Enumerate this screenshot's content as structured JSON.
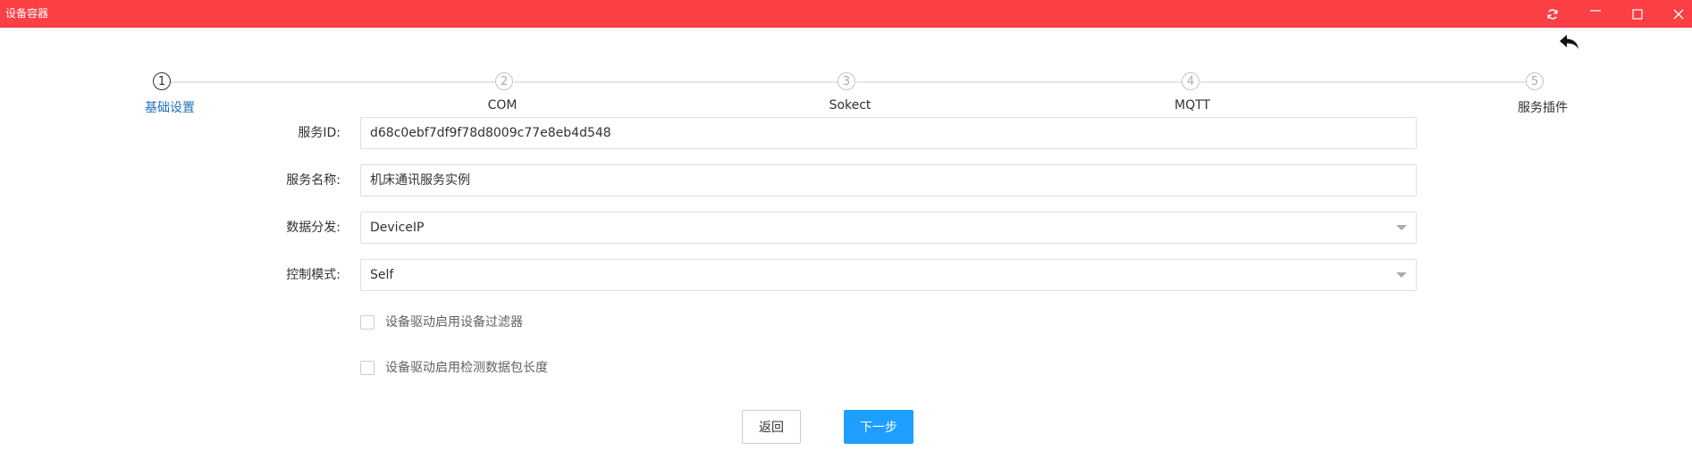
{
  "window": {
    "title": "设备容器",
    "controls": [
      "refresh-icon",
      "minimize-icon",
      "maximize-icon",
      "close-icon"
    ]
  },
  "toolbar": {
    "back_icon": "undo-arrow-icon"
  },
  "steps": [
    {
      "number": "1",
      "label": "基础设置",
      "active": true
    },
    {
      "number": "2",
      "label": "COM",
      "active": false
    },
    {
      "number": "3",
      "label": "Sokect",
      "active": false
    },
    {
      "number": "4",
      "label": "MQTT",
      "active": false
    },
    {
      "number": "5",
      "label": "服务插件",
      "active": false
    }
  ],
  "form": {
    "service_id_label": "服务ID:",
    "service_id_value": "d68c0ebf7df9f78d8009c77e8eb4d548",
    "service_name_label": "服务名称:",
    "service_name_value": "机床通讯服务实例",
    "data_dispatch_label": "数据分发:",
    "data_dispatch_value": "DeviceIP",
    "control_mode_label": "控制模式:",
    "control_mode_value": "Self",
    "checkbox_filter_label": "设备驱动启用设备过滤器",
    "checkbox_filter_checked": false,
    "checkbox_length_label": "设备驱动启用检测数据包长度",
    "checkbox_length_checked": false
  },
  "buttons": {
    "back_label": "返回",
    "next_label": "下一步"
  },
  "colors": {
    "titlebar": "#fc3f45",
    "primary": "#1e9fff",
    "active_step": "#1f6fbf"
  }
}
